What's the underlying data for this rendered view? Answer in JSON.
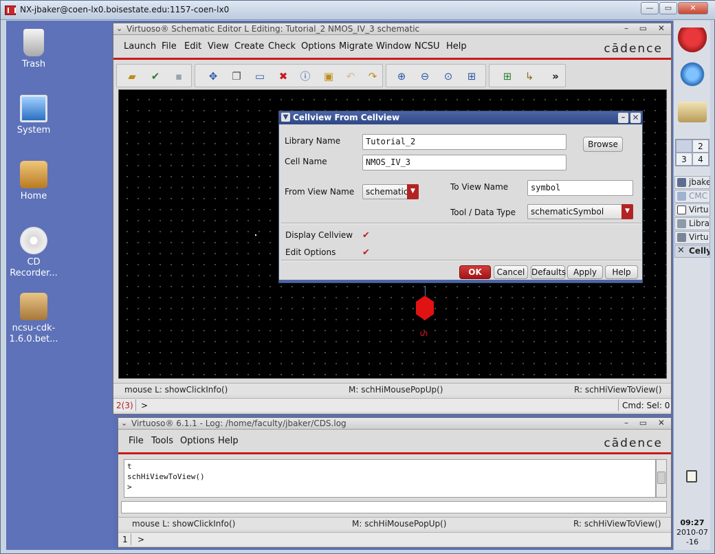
{
  "nx": {
    "title": "NX-jbaker@coen-lx0.boisestate.edu:1157-coen-lx0",
    "controls": {
      "minimize": "—",
      "maximize": "▭",
      "close": "✕"
    }
  },
  "desktop": {
    "icons": [
      {
        "label": "Trash",
        "icon": "trash-icon"
      },
      {
        "label": "System",
        "icon": "computer-icon"
      },
      {
        "label": "Home",
        "icon": "home-folder-icon"
      },
      {
        "label": "CD Recorder...",
        "icon": "cd-icon"
      },
      {
        "label": "ncsu-cdk-1.6.0.bet...",
        "icon": "package-icon"
      }
    ]
  },
  "panel": {
    "workspaces": [
      "",
      "2",
      "3",
      "4"
    ],
    "tasks": [
      "jbake",
      "CMC",
      "Virtu",
      "Libra",
      "Virtu",
      "Celly"
    ],
    "clock_time": "09:27",
    "clock_date_line1": "2010-07",
    "clock_date_line2": "-16"
  },
  "schematic": {
    "title": "Virtuoso® Schematic Editor L Editing: Tutorial_2 NMOS_IV_3 schematic",
    "menu": [
      "Launch",
      "File",
      "Edit",
      "View",
      "Create",
      "Check",
      "Options",
      "Migrate",
      "Window",
      "NCSU",
      "Help"
    ],
    "brand": "cādence",
    "pin_label": "S",
    "status": {
      "left": "mouse L: showClickInfo()",
      "middle": "M: schHiMousePopUp()",
      "right": "R: schHiViewToView()"
    },
    "cmd": {
      "counter": "2(3)",
      "prompt": ">",
      "sel": "Cmd: Sel: 0"
    },
    "toolbar_more": "»"
  },
  "dialog": {
    "title": "Cellview From Cellview",
    "library_name_label": "Library Name",
    "library_name_value": "Tutorial_2",
    "browse_label": "Browse",
    "cell_name_label": "Cell Name",
    "cell_name_value": "NMOS_IV_3",
    "from_view_label": "From View Name",
    "from_view_value": "schematic",
    "to_view_label": "To View Name",
    "to_view_value": "symbol",
    "tool_label": "Tool / Data Type",
    "tool_value": "schematicSymbol",
    "display_cellview_label": "Display Cellview",
    "display_cellview_checked": true,
    "edit_options_label": "Edit Options",
    "edit_options_checked": true,
    "buttons": {
      "ok": "OK",
      "cancel": "Cancel",
      "defaults": "Defaults",
      "apply": "Apply",
      "help": "Help"
    }
  },
  "log": {
    "title": "Virtuoso® 6.1.1 - Log: /home/faculty/jbaker/CDS.log",
    "menu": [
      "File",
      "Tools",
      "Options",
      "Help"
    ],
    "brand": "cādence",
    "lines": [
      "t",
      "schHiViewToView()",
      ">"
    ],
    "status": {
      "left": "mouse L: showClickInfo()",
      "middle": "M: schHiMousePopUp()",
      "right": "R: schHiViewToView()"
    },
    "cmd": {
      "counter": "1",
      "prompt": ">"
    }
  },
  "colors": {
    "accent_red": "#c81a1a",
    "dialog_title": "#2f4785",
    "desktop": "#5a6fb5"
  }
}
